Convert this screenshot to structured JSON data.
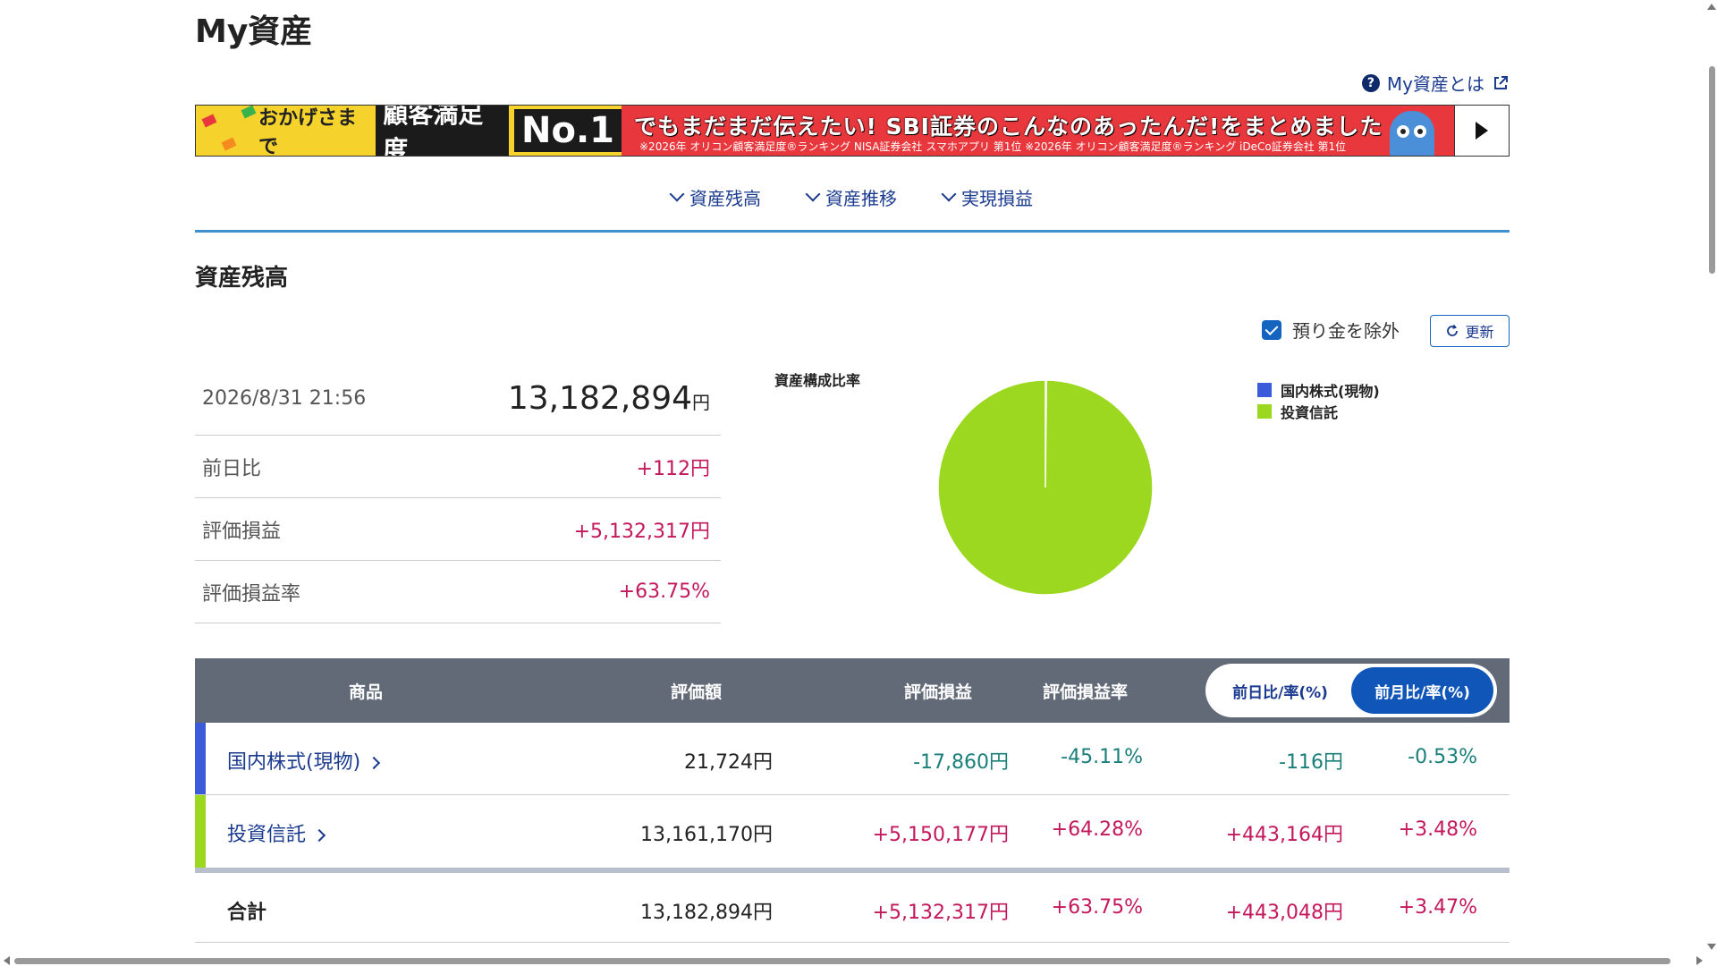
{
  "page": {
    "title": "My資産"
  },
  "help": {
    "label": "My資産とは"
  },
  "banner": {
    "lead": "おかげさまで",
    "highlight": "顧客満足度",
    "no1": "No.1",
    "headline": "でもまだまだ伝えたい! SBI証券のこんなのあったんだ!をまとめました",
    "note": "※2026年 オリコン顧客満足度®ランキング NISA証券会社 スマホアプリ 第1位 ※2026年 オリコン顧客満足度®ランキング iDeCo証券会社 第1位"
  },
  "nav": {
    "items": [
      {
        "label": "資産残高"
      },
      {
        "label": "資産推移"
      },
      {
        "label": "実現損益"
      }
    ]
  },
  "section": {
    "title": "資産残高"
  },
  "controls": {
    "exclude_label": "預り金を除外",
    "exclude_checked": true,
    "refresh_label": "更新"
  },
  "summary": {
    "datetime": "2026/8/31 21:56",
    "total_value": "13,182,894",
    "yen": "円",
    "rows": [
      {
        "label": "前日比",
        "value": "+112円"
      },
      {
        "label": "評価損益",
        "value": "+5,132,317円"
      },
      {
        "label": "評価損益率",
        "value": "+63.75%"
      }
    ]
  },
  "chart_data": {
    "type": "pie",
    "title": "資産構成比率",
    "legend_position": "right",
    "slices": [
      {
        "name": "国内株式(現物)",
        "value": 21724,
        "color": "#3b5bdb"
      },
      {
        "name": "投資信託",
        "value": 13161170,
        "color": "#9bd81f"
      }
    ]
  },
  "table": {
    "headers": {
      "product": "商品",
      "eval": "評価額",
      "pl": "評価損益",
      "rate": "評価損益率"
    },
    "toggle": {
      "daily": "前日比/率(%)",
      "monthly": "前月比/率(%)",
      "active": "monthly"
    },
    "rows": [
      {
        "name": "国内株式(現物)",
        "color": "#3b5bdb",
        "eval": "21,724円",
        "pl": "-17,860円",
        "rate": "-45.11%",
        "diff": "-116円",
        "diff_rate": "-0.53%",
        "sign": "neg"
      },
      {
        "name": "投資信託",
        "color": "#9bd81f",
        "eval": "13,161,170円",
        "pl": "+5,150,177円",
        "rate": "+64.28%",
        "diff": "+443,164円",
        "diff_rate": "+3.48%",
        "sign": "pos"
      }
    ],
    "total": {
      "name": "合計",
      "eval": "13,182,894円",
      "pl": "+5,132,317円",
      "rate": "+63.75%",
      "diff": "+443,048円",
      "diff_rate": "+3.47%"
    }
  }
}
